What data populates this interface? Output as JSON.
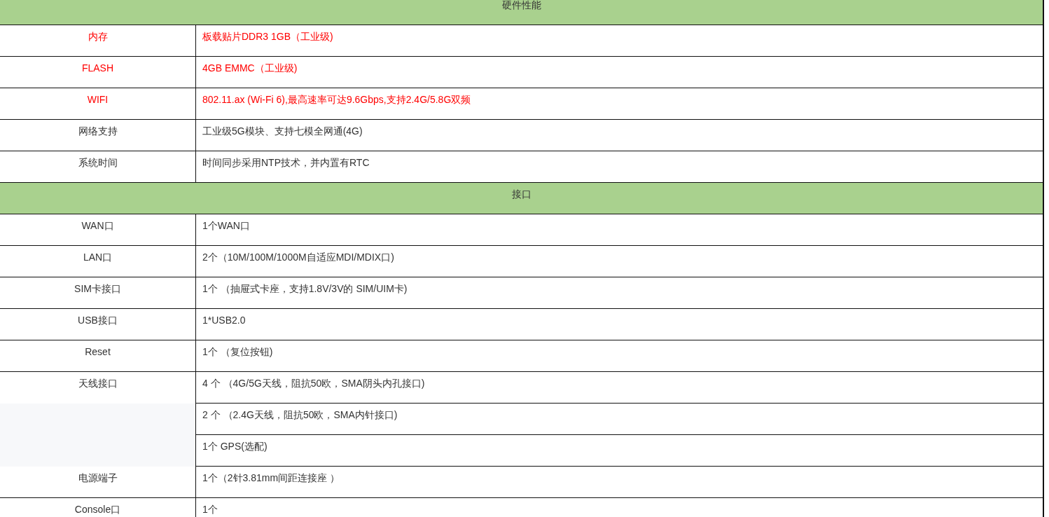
{
  "sections": [
    {
      "title": "硬件性能",
      "rows": [
        {
          "kind": "spec",
          "label": "内存",
          "value": "板载贴片DDR3 1GB（工业级)",
          "color": "#ff0000"
        },
        {
          "kind": "spec",
          "label": "FLASH",
          "value": "4GB EMMC（工业级)",
          "color": "#ff0000"
        },
        {
          "kind": "spec",
          "label": "WIFI",
          "value": "802.11.ax (Wi-Fi 6),最高速率可达9.6Gbps,支持2.4G/5.8G双频",
          "color": "#ff0000"
        },
        {
          "kind": "spec",
          "label": "网络支持",
          "value": "工业级5G模块、支持七模全网通(4G)",
          "color": "#333333"
        },
        {
          "kind": "spec",
          "label": "系统时间",
          "value": "时间同步采用NTP技术，并内置有RTC",
          "color": "#333333"
        }
      ]
    },
    {
      "title": "接口",
      "rows": [
        {
          "kind": "spec",
          "label": "WAN口",
          "value": "1个WAN口",
          "color": "#333333"
        },
        {
          "kind": "spec",
          "label": "LAN口",
          "value": "2个（10M/100M/1000M自适应MDI/MDIX口)",
          "color": "#333333"
        },
        {
          "kind": "spec",
          "label": "SIM卡接口",
          "value": "1个 （抽屉式卡座，支持1.8V/3V的 SIM/UIM卡)",
          "color": "#333333"
        },
        {
          "kind": "spec",
          "label": "USB接口",
          "value": "1*USB2.0",
          "color": "#333333"
        },
        {
          "kind": "spec",
          "label": "Reset",
          "value": "1个 （复位按钮)",
          "color": "#333333"
        },
        {
          "kind": "spec",
          "label": "天线接口",
          "value": "4 个 （4G/5G天线，阻抗50欧，SMA阴头内孔接口)",
          "color": "#333333"
        },
        {
          "kind": "continuation",
          "value": "2 个 （2.4G天线，阻抗50欧，SMA内针接口)",
          "color": "#333333"
        },
        {
          "kind": "continuation",
          "value": "1个 GPS(选配)",
          "color": "#333333"
        },
        {
          "kind": "spec",
          "label": "电源端子",
          "value": "1个（2针3.81mm间距连接座 ）",
          "color": "#333333"
        },
        {
          "kind": "spec",
          "label": "Console口",
          "value": "1个",
          "color": "#333333"
        }
      ]
    }
  ]
}
